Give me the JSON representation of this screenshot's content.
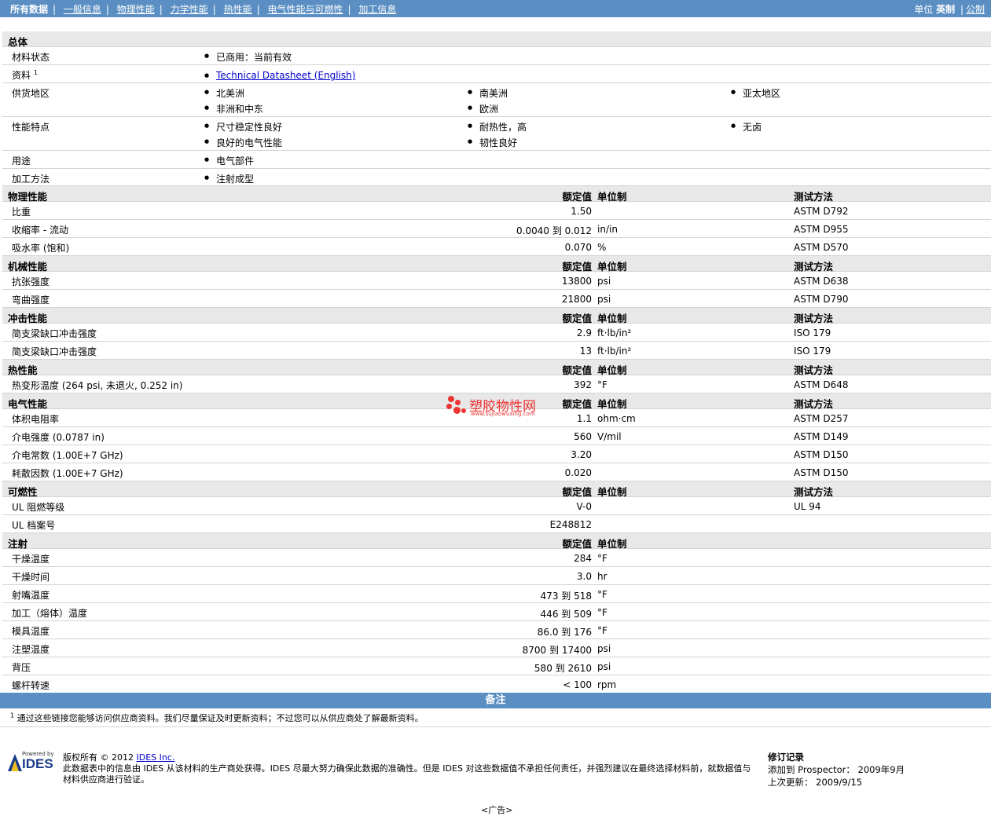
{
  "nav": {
    "active": "所有数据",
    "links": [
      "一般信息",
      "物理性能",
      "力学性能",
      "热性能",
      "电气性能与可燃性",
      "加工信息"
    ],
    "units_label": "单位",
    "unit_english": "英制",
    "unit_metric": "公制"
  },
  "general": {
    "title": "总体",
    "status_label": "材料状态",
    "status_value": "已商用：当前有效",
    "docs_label": "资料",
    "docs_sup": "1",
    "docs_link": "Technical Datasheet (English)",
    "region_label": "供货地区",
    "regions": [
      "北美洲",
      "南美洲",
      "亚太地区",
      "非洲和中东",
      "欧洲"
    ],
    "features_label": "性能特点",
    "features": [
      "尺寸稳定性良好",
      "耐热性，高",
      "无卤",
      "良好的电气性能",
      "韧性良好"
    ],
    "use_label": "用途",
    "use_value": "电气部件",
    "process_label": "加工方法",
    "process_value": "注射成型"
  },
  "headers": {
    "nominal": "额定值",
    "unit": "单位制",
    "test": "测试方法"
  },
  "physical": {
    "title": "物理性能",
    "rows": [
      {
        "label": "比重",
        "value": "1.50",
        "unit": "",
        "test": "ASTM D792"
      },
      {
        "label": "收缩率 - 流动",
        "value": "0.0040 到 0.012",
        "unit": "in/in",
        "test": "ASTM D955"
      },
      {
        "label": "吸水率 (饱和)",
        "value": "0.070",
        "unit": "%",
        "test": "ASTM D570"
      }
    ]
  },
  "mechanical": {
    "title": "机械性能",
    "rows": [
      {
        "label": "抗张强度",
        "value": "13800",
        "unit": "psi",
        "test": "ASTM D638"
      },
      {
        "label": "弯曲强度",
        "value": "21800",
        "unit": "psi",
        "test": "ASTM D790"
      }
    ]
  },
  "impact": {
    "title": "冲击性能",
    "rows": [
      {
        "label": "简支梁缺口冲击强度",
        "value": "2.9",
        "unit": "ft·lb/in²",
        "test": "ISO 179"
      },
      {
        "label": "简支梁缺口冲击强度",
        "value": "13",
        "unit": "ft·lb/in²",
        "test": "ISO 179"
      }
    ]
  },
  "thermal": {
    "title": "热性能",
    "rows": [
      {
        "label": "热变形温度 (264 psi, 未退火, 0.252 in)",
        "value": "392",
        "unit": "°F",
        "test": "ASTM D648"
      }
    ]
  },
  "electrical": {
    "title": "电气性能",
    "rows": [
      {
        "label": "体积电阻率",
        "value": "1.1",
        "unit": "ohm·cm",
        "test": "ASTM D257"
      },
      {
        "label": "介电强度 (0.0787 in)",
        "value": "560",
        "unit": "V/mil",
        "test": "ASTM D149"
      },
      {
        "label": "介电常数 (1.00E+7 GHz)",
        "value": "3.20",
        "unit": "",
        "test": "ASTM D150"
      },
      {
        "label": "耗散因数 (1.00E+7 GHz)",
        "value": "0.020",
        "unit": "",
        "test": "ASTM D150"
      }
    ]
  },
  "flammability": {
    "title": "可燃性",
    "rows": [
      {
        "label": "UL 阻燃等级",
        "value": "V-0",
        "unit": "",
        "test": "UL 94"
      },
      {
        "label": "UL 档案号",
        "value": "E248812",
        "unit": "",
        "test": ""
      }
    ]
  },
  "injection": {
    "title": "注射",
    "rows": [
      {
        "label": "干燥温度",
        "value": "284",
        "unit": "°F",
        "test": ""
      },
      {
        "label": "干燥时间",
        "value": "3.0",
        "unit": "hr",
        "test": ""
      },
      {
        "label": "射嘴温度",
        "value": "473 到 518",
        "unit": "°F",
        "test": ""
      },
      {
        "label": "加工（熔体）温度",
        "value": "446 到 509",
        "unit": "°F",
        "test": ""
      },
      {
        "label": "模具温度",
        "value": "86.0 到 176",
        "unit": "°F",
        "test": ""
      },
      {
        "label": "注塑温度",
        "value": "8700 到 17400",
        "unit": "psi",
        "test": ""
      },
      {
        "label": "背压",
        "value": "580 到 2610",
        "unit": "psi",
        "test": ""
      },
      {
        "label": "螺杆转速",
        "value": "< 100",
        "unit": "rpm",
        "test": ""
      }
    ]
  },
  "notes": {
    "title": "备注",
    "sup": "1",
    "text": "通过这些链接您能够访问供应商资料。我们尽量保证及时更新资料；不过您可以从供应商处了解最新资料。"
  },
  "footer": {
    "powered_by": "Powered by",
    "logo_text": "IDES",
    "copyright_prefix": "版权所有 © 2012",
    "copyright_link": "IDES Inc.",
    "disclaimer": "此数据表中的信息由 IDES 从该材料的生产商处获得。IDES 尽最大努力确保此数据的准确性。但是 IDES 对这些数据值不承担任何责任，并强烈建议在最终选择材料前，就数据值与材料供应商进行验证。",
    "rev_title": "修订记录",
    "rev_added_label": "添加到 Prospector：",
    "rev_added": "2009年9月",
    "rev_updated_label": "上次更新：",
    "rev_updated": "2009/9/15",
    "ad": "<广告>"
  },
  "watermark": {
    "cn": "塑胶物性网",
    "en": "www.sujiaowuxing.com"
  }
}
